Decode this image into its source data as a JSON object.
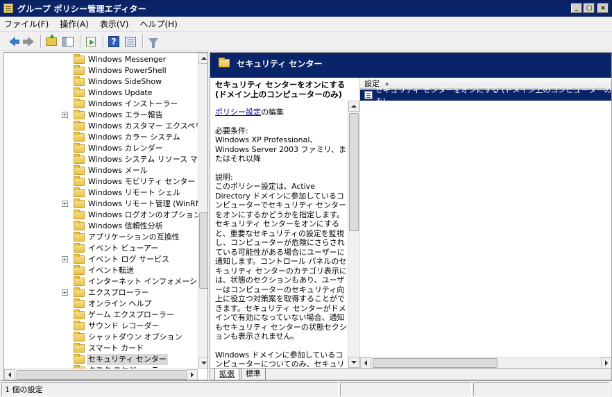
{
  "window": {
    "title": "グループ ポリシー管理エディター",
    "minimize": "_",
    "maximize": "□",
    "close": "×"
  },
  "menu": [
    "ファイル(F)",
    "操作(A)",
    "表示(V)",
    "ヘルプ(H)"
  ],
  "toolbar": {
    "help": "?"
  },
  "tree": {
    "items": [
      {
        "label": "Windows Messenger",
        "expandable": false
      },
      {
        "label": "Windows PowerShell",
        "expandable": false
      },
      {
        "label": "Windows SideShow",
        "expandable": false
      },
      {
        "label": "Windows Update",
        "expandable": false
      },
      {
        "label": "Windows インストーラー",
        "expandable": false
      },
      {
        "label": "Windows エラー報告",
        "expandable": true
      },
      {
        "label": "Windows カスタマー エクスペリエン",
        "expandable": false
      },
      {
        "label": "Windows カラー システム",
        "expandable": false
      },
      {
        "label": "Windows カレンダー",
        "expandable": false
      },
      {
        "label": "Windows システム リソース マネー",
        "expandable": false
      },
      {
        "label": "Windows メール",
        "expandable": false
      },
      {
        "label": "Windows モビリティ センター",
        "expandable": false
      },
      {
        "label": "Windows リモート シェル",
        "expandable": false
      },
      {
        "label": "Windows リモート管理 (WinRM)",
        "expandable": true
      },
      {
        "label": "Windows ログオンのオプション",
        "expandable": false
      },
      {
        "label": "Windows 信頼性分析",
        "expandable": false
      },
      {
        "label": "アプリケーションの互換性",
        "expandable": false
      },
      {
        "label": "イベント ビューアー",
        "expandable": false
      },
      {
        "label": "イベント ログ サービス",
        "expandable": true
      },
      {
        "label": "イベント転送",
        "expandable": false
      },
      {
        "label": "インターネット インフォメーション サ",
        "expandable": false
      },
      {
        "label": "エクスプローラー",
        "expandable": true
      },
      {
        "label": "オンライン ヘルプ",
        "expandable": false
      },
      {
        "label": "ゲーム エクスプローラー",
        "expandable": false
      },
      {
        "label": "サウンド レコーダー",
        "expandable": false
      },
      {
        "label": "シャットダウン オプション",
        "expandable": false
      },
      {
        "label": "スマート カード",
        "expandable": false
      },
      {
        "label": "セキュリティ センター",
        "expandable": false,
        "selected": true
      },
      {
        "label": "タスク スケジューラ",
        "expandable": false
      }
    ],
    "expander_symbol": "+"
  },
  "right_pane": {
    "header_title": "セキュリティ センター",
    "description": {
      "title": "セキュリティ センターをオンにする (ドメイン上のコンピューターのみ)",
      "edit_link": "ポリシー設定",
      "edit_suffix": "の編集",
      "requirements_label": "必要条件:",
      "requirements_text": "Windows XP Professional、Windows Server 2003 ファミリ、またはそれ以降",
      "explanation_label": "説明:",
      "explanation_text": "このポリシー設定は、Active Directory ドメインに参加しているコンピューターでセキュリティ センターをオンにするかどうかを指定します。セキュリティ センターをオンにすると、重要なセキュリティの設定を監視し、コンピューターが危険にさらされている可能性がある場合にユーザーに通知します。コントロール パネルのセキュリティ センターのカテゴリ表示には、状態のセクションもあり、ユーザーはコンピューターのセキュリティ向上に役立つ対策案を取得することができます。セキュリティ センターがドメインで有効になっていない場合、通知もセキュリティ センターの状態セクションも表示されません。",
      "extra_text": "Windows ドメインに参加しているコンピューターについてのみ、セキュリティ センターをオフにすることができます。コンピューターが Windows ドメインに参加していない場合、このポリシー設定は何の影響も与えません。"
    },
    "list": {
      "column": "設定",
      "rows": [
        "セキュリティ センターをオンにする (ドメイン上のコンピューターのみ)"
      ]
    },
    "tabs": [
      "拡張",
      "標準"
    ]
  },
  "status": {
    "text": "1 個の設定"
  }
}
